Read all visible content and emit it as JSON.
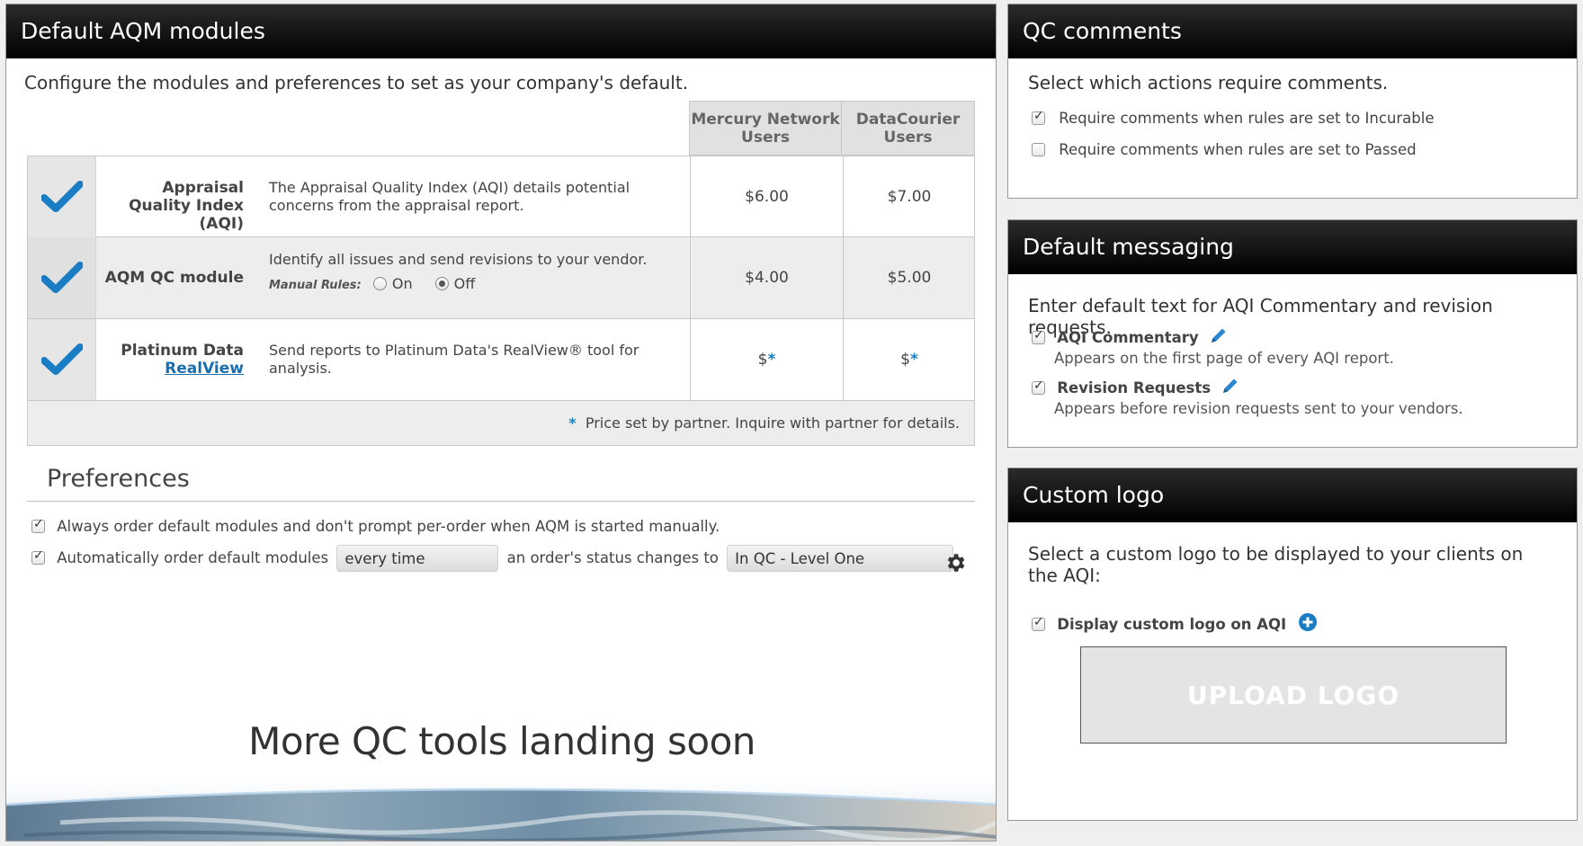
{
  "modules_panel": {
    "title": "Default AQM modules",
    "intro": "Configure the modules and preferences to set as your company's default.",
    "columns": [
      "Mercury Network Users",
      "DataCourier Users"
    ],
    "rows": [
      {
        "name": "Appraisal Quality Index (AQI)",
        "description": "The Appraisal Quality Index (AQI) details potential concerns from the appraisal report.",
        "price_mercury": "$6.00",
        "price_datacourier": "$7.00",
        "checked": true
      },
      {
        "name": "AQM QC module",
        "description": "Identify all issues and send revisions to your vendor.",
        "manual_rules_label": "Manual Rules:",
        "radio_on": "On",
        "radio_off": "Off",
        "selected": "Off",
        "price_mercury": "$4.00",
        "price_datacourier": "$5.00",
        "checked": true
      },
      {
        "name": "Platinum Data",
        "link": "RealView",
        "description": "Send reports to Platinum Data's RealView® tool for analysis.",
        "price_mercury": "$",
        "price_datacourier": "$",
        "star": "*",
        "checked": true
      }
    ],
    "footnote_star": "*",
    "footnote": "Price set by partner. Inquire with partner for details."
  },
  "preferences": {
    "title": "Preferences",
    "option1": "Always order default modules and don't prompt per-order when AQM is started manually.",
    "option2_prefix": "Automatically order default modules",
    "frequency": "every time",
    "option2_middle": "an order's status changes to",
    "status": "In QC - Level One",
    "option1_checked": true,
    "option2_checked": true
  },
  "coming_soon": "More QC tools landing soon",
  "qc_comments": {
    "title": "QC comments",
    "intro": "Select which actions require comments.",
    "options": [
      {
        "label": "Require comments when rules are set to Incurable",
        "checked": true
      },
      {
        "label": "Require comments when rules are set to Passed",
        "checked": false
      }
    ]
  },
  "default_messaging": {
    "title": "Default messaging",
    "intro": "Enter default text for AQI Commentary and revision requests.",
    "items": [
      {
        "label": "AQI Commentary",
        "description": "Appears on the first page of every AQI report.",
        "checked": true
      },
      {
        "label": "Revision Requests",
        "description": "Appears before revision requests sent to your vendors.",
        "checked": true
      }
    ]
  },
  "custom_logo": {
    "title": "Custom logo",
    "intro": "Select a custom logo to be displayed to your clients on the AQI:",
    "option": "Display custom logo on AQI",
    "checked": true,
    "upload": "UPLOAD LOGO"
  },
  "colors": {
    "accent": "#1a7dc4",
    "header": "#000000"
  }
}
